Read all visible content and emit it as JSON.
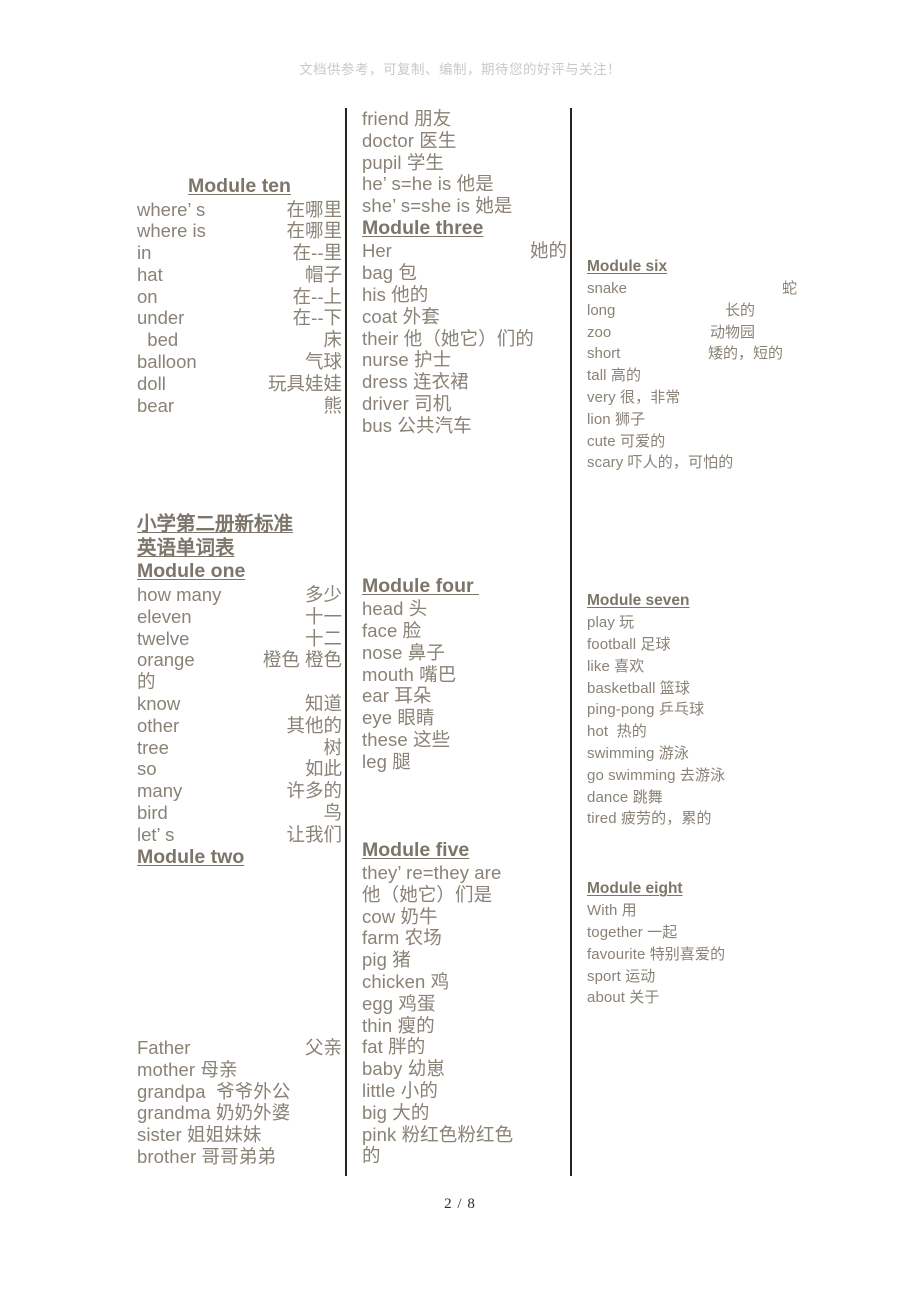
{
  "document": {
    "header_watermark": "文档供参考，可复制、编制，期待您的好评与关注！",
    "footer_page": "2 / 8",
    "text_color": "#8a8277",
    "heading_color": "#7d756a",
    "rule_color": "#26241f",
    "watermark_color": "#c9c9c9"
  },
  "columns": {
    "left": {
      "module_ten": {
        "heading": "Module ten",
        "entries": [
          {
            "en": "where’ s",
            "cn": "在哪里"
          },
          {
            "en": "where is",
            "cn": "在哪里"
          },
          {
            "en": "in",
            "cn": "在--里"
          },
          {
            "en": "hat",
            "cn": "帽子"
          },
          {
            "en": "on",
            "cn": "在--上"
          },
          {
            "en": "under",
            "cn": "在--下"
          },
          {
            "en": "  bed",
            "cn": "床"
          },
          {
            "en": "balloon",
            "cn": "气球"
          },
          {
            "en": "doll",
            "cn": "玩具娃娃"
          },
          {
            "en": "bear",
            "cn": "熊"
          }
        ]
      },
      "title": {
        "line1": "小学第二册新标准",
        "line2": "英语单词表"
      },
      "module_one": {
        "heading": "Module one",
        "entries": [
          {
            "en": "how many",
            "cn": "多少"
          },
          {
            "en": "eleven",
            "cn": "十一"
          },
          {
            "en": "twelve",
            "cn": "十二"
          },
          {
            "en": "orange",
            "cn": "橙色 橙色"
          },
          {
            "en": "的",
            "cn": ""
          },
          {
            "en": "know",
            "cn": "知道"
          },
          {
            "en": "other",
            "cn": "其他的"
          },
          {
            "en": "tree",
            "cn": "树"
          },
          {
            "en": "so",
            "cn": "如此"
          },
          {
            "en": "many",
            "cn": "许多的"
          },
          {
            "en": "bird",
            "cn": "鸟"
          },
          {
            "en": "let’ s",
            "cn": "让我们"
          }
        ]
      },
      "module_two": {
        "heading": "Module two",
        "entries": [
          {
            "en": "Father",
            "cn": "父亲"
          },
          {
            "en": "mother 母亲",
            "cn": ""
          },
          {
            "en": "grandpa  爷爷外公",
            "cn": ""
          },
          {
            "en": "grandma 奶奶外婆",
            "cn": ""
          },
          {
            "en": "sister 姐姐妹妹",
            "cn": ""
          },
          {
            "en": "brother 哥哥弟弟",
            "cn": ""
          }
        ]
      }
    },
    "mid": {
      "module_two_cont": {
        "entries": [
          {
            "en": "friend 朋友",
            "cn": ""
          },
          {
            "en": "doctor 医生",
            "cn": ""
          },
          {
            "en": "pupil 学生",
            "cn": ""
          },
          {
            "en": "he’ s=he is 他是",
            "cn": ""
          },
          {
            "en": "she’ s=she is 她是",
            "cn": ""
          }
        ]
      },
      "module_three": {
        "heading": "Module three",
        "entries": [
          {
            "en": "Her",
            "cn": "她的"
          },
          {
            "en": "bag 包",
            "cn": ""
          },
          {
            "en": "his 他的",
            "cn": ""
          },
          {
            "en": "coat 外套",
            "cn": ""
          },
          {
            "en": "their 他（她它）们的",
            "cn": ""
          },
          {
            "en": "nurse 护士",
            "cn": ""
          },
          {
            "en": "dress 连衣裙",
            "cn": ""
          },
          {
            "en": "driver 司机",
            "cn": ""
          },
          {
            "en": "bus 公共汽车",
            "cn": ""
          }
        ]
      },
      "module_four": {
        "heading": "Module four ",
        "entries": [
          {
            "en": "head 头",
            "cn": ""
          },
          {
            "en": "face 脸",
            "cn": ""
          },
          {
            "en": "nose 鼻子",
            "cn": ""
          },
          {
            "en": "mouth 嘴巴",
            "cn": ""
          },
          {
            "en": "ear 耳朵",
            "cn": ""
          },
          {
            "en": "eye 眼睛",
            "cn": ""
          },
          {
            "en": "these 这些",
            "cn": ""
          },
          {
            "en": "leg 腿",
            "cn": ""
          }
        ]
      },
      "module_five": {
        "heading": "Module five",
        "entries": [
          {
            "en": "they’ re=they are",
            "cn": ""
          },
          {
            "en": "他（她它）们是",
            "cn": ""
          },
          {
            "en": "cow 奶牛",
            "cn": ""
          },
          {
            "en": "farm 农场",
            "cn": ""
          },
          {
            "en": "pig 猪",
            "cn": ""
          },
          {
            "en": "chicken 鸡",
            "cn": ""
          },
          {
            "en": "egg 鸡蛋",
            "cn": ""
          },
          {
            "en": "thin 瘦的",
            "cn": ""
          },
          {
            "en": "fat 胖的",
            "cn": ""
          },
          {
            "en": "baby 幼崽",
            "cn": ""
          },
          {
            "en": "little 小的",
            "cn": ""
          },
          {
            "en": "big 大的",
            "cn": ""
          },
          {
            "en": "pink 粉红色粉红色",
            "cn": ""
          },
          {
            "en": "的",
            "cn": ""
          }
        ]
      }
    },
    "right": {
      "module_six": {
        "heading": "Module six",
        "entries": [
          {
            "en": "snake",
            "cn": "蛇"
          },
          {
            "en": "long",
            "cn": "长的"
          },
          {
            "en": "zoo",
            "cn": "动物园"
          },
          {
            "en": "short",
            "cn": "矮的，短的"
          },
          {
            "en": "tall 高的",
            "cn": ""
          },
          {
            "en": "very 很，非常",
            "cn": ""
          },
          {
            "en": "lion 狮子",
            "cn": ""
          },
          {
            "en": "cute 可爱的",
            "cn": ""
          },
          {
            "en": "scary 吓人的，可怕的",
            "cn": ""
          }
        ]
      },
      "module_seven": {
        "heading": "Module seven",
        "entries": [
          {
            "en": "play 玩",
            "cn": ""
          },
          {
            "en": "football 足球",
            "cn": ""
          },
          {
            "en": "like 喜欢",
            "cn": ""
          },
          {
            "en": "basketball 篮球",
            "cn": ""
          },
          {
            "en": "ping-pong 乒乓球",
            "cn": ""
          },
          {
            "en": "hot  热的",
            "cn": ""
          },
          {
            "en": "swimming 游泳",
            "cn": ""
          },
          {
            "en": "go swimming 去游泳",
            "cn": ""
          },
          {
            "en": "dance 跳舞",
            "cn": ""
          },
          {
            "en": "tired 疲劳的，累的",
            "cn": ""
          }
        ]
      },
      "module_eight": {
        "heading": "Module eight",
        "entries": [
          {
            "en": "With 用",
            "cn": ""
          },
          {
            "en": "together 一起",
            "cn": ""
          },
          {
            "en": "favourite 特别喜爱的",
            "cn": ""
          },
          {
            "en": "sport 运动",
            "cn": ""
          },
          {
            "en": "about 关于",
            "cn": ""
          }
        ]
      }
    }
  }
}
